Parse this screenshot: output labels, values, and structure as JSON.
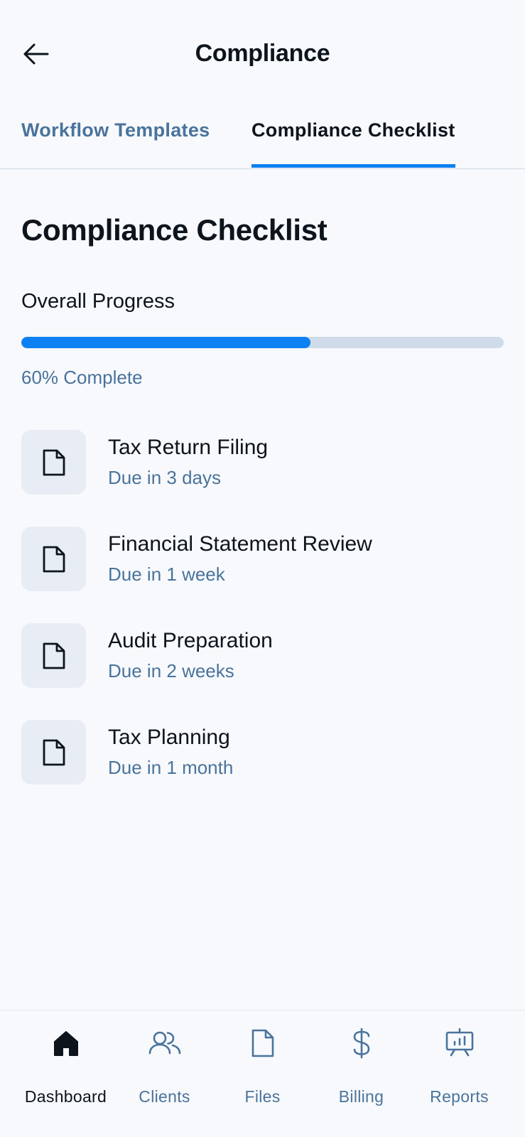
{
  "header": {
    "title": "Compliance",
    "back_icon": "arrow-left-icon"
  },
  "tabs": [
    {
      "label": "Workflow Templates",
      "active": false
    },
    {
      "label": "Compliance Checklist",
      "active": true
    }
  ],
  "main": {
    "heading": "Compliance Checklist",
    "progress": {
      "label": "Overall Progress",
      "value_percent": 60,
      "text": "60% Complete"
    },
    "items": [
      {
        "title": "Tax Return Filing",
        "due": "Due in 3 days",
        "icon": "document-icon"
      },
      {
        "title": "Financial Statement Review",
        "due": "Due in 1 week",
        "icon": "document-icon"
      },
      {
        "title": "Audit Preparation",
        "due": "Due in 2 weeks",
        "icon": "document-icon"
      },
      {
        "title": "Tax Planning",
        "due": "Due in 1 month",
        "icon": "document-icon"
      }
    ]
  },
  "nav": [
    {
      "label": "Dashboard",
      "icon": "home-icon",
      "active": true
    },
    {
      "label": "Clients",
      "icon": "users-icon",
      "active": false
    },
    {
      "label": "Files",
      "icon": "file-icon",
      "active": false
    },
    {
      "label": "Billing",
      "icon": "dollar-icon",
      "active": false
    },
    {
      "label": "Reports",
      "icon": "presentation-chart-icon",
      "active": false
    }
  ],
  "colors": {
    "accent": "#0d80f2",
    "text_primary": "#0d141c",
    "text_secondary": "#4a739c",
    "track": "#cfdbe8",
    "icon_tile": "#e8edf5",
    "background": "#f7f9fc"
  }
}
